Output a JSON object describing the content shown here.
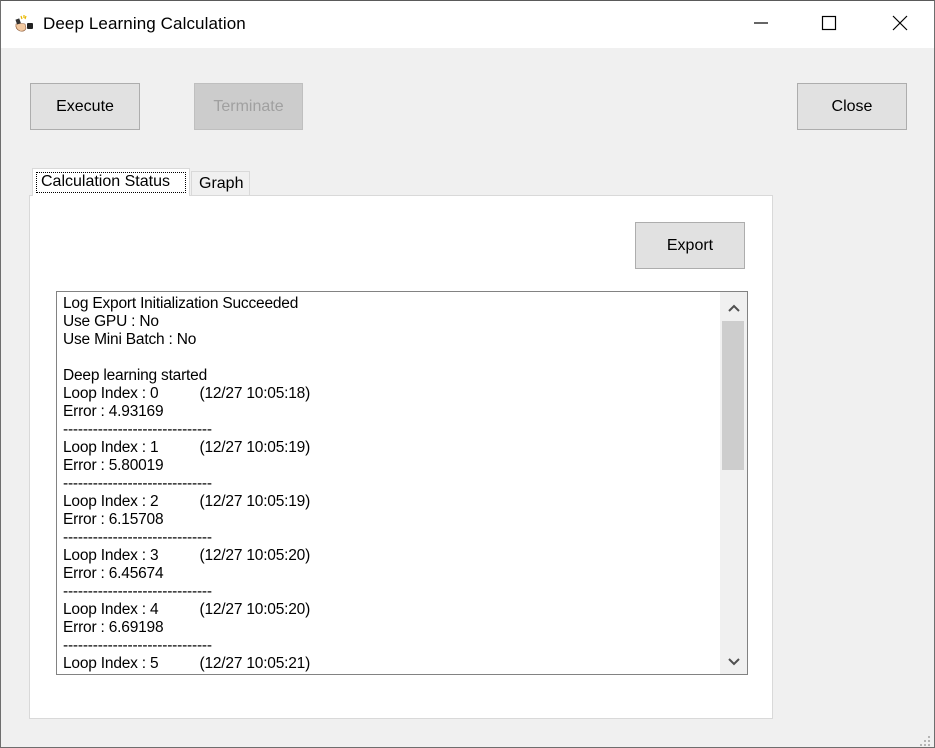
{
  "window": {
    "title": "Deep Learning Calculation",
    "app_icon": "cartoon-hand-app-icon",
    "controls": {
      "minimize_icon": "minimize-icon",
      "maximize_icon": "maximize-icon",
      "close_icon": "close-icon"
    }
  },
  "toolbar": {
    "execute_label": "Execute",
    "terminate_label": "Terminate",
    "terminate_enabled": false,
    "close_label": "Close"
  },
  "tabs": [
    {
      "label": "Calculation Status",
      "selected": true
    },
    {
      "label": "Graph",
      "selected": false
    }
  ],
  "calculation_status": {
    "export_label": "Export",
    "log_lines": [
      "Log Export Initialization Succeeded",
      "Use GPU : No",
      "Use Mini Batch : No",
      "",
      "Deep learning started",
      "Loop Index : 0          (12/27 10:05:18)",
      "Error : 4.93169",
      "------------------------------",
      "Loop Index : 1          (12/27 10:05:19)",
      "Error : 5.80019",
      "------------------------------",
      "Loop Index : 2          (12/27 10:05:19)",
      "Error : 6.15708",
      "------------------------------",
      "Loop Index : 3          (12/27 10:05:20)",
      "Error : 6.45674",
      "------------------------------",
      "Loop Index : 4          (12/27 10:05:20)",
      "Error : 6.69198",
      "------------------------------",
      "Loop Index : 5          (12/27 10:05:21)"
    ],
    "scrollbar": {
      "up_icon": "chevron-up-icon",
      "down_icon": "chevron-down-icon"
    }
  }
}
